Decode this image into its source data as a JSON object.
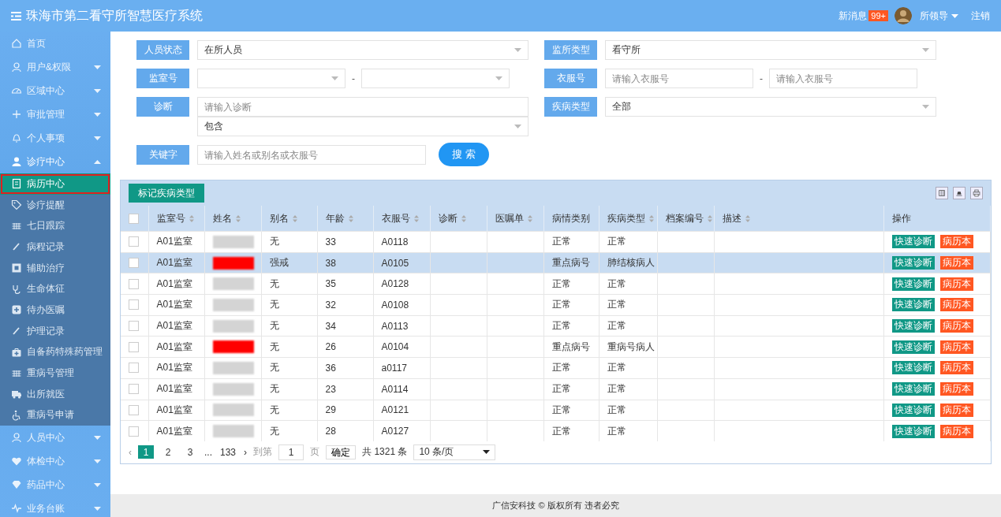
{
  "header": {
    "title": "珠海市第二看守所智慧医疗系统",
    "messages_label": "新消息",
    "messages_badge": "99+",
    "user": "所领导",
    "logout": "注销"
  },
  "sidebar": {
    "items": [
      {
        "label": "首页"
      },
      {
        "label": "用户&权限",
        "expanded": false
      },
      {
        "label": "区域中心",
        "expanded": false
      },
      {
        "label": "审批管理",
        "expanded": false
      },
      {
        "label": "个人事项",
        "expanded": false
      },
      {
        "label": "诊疗中心",
        "expanded": true,
        "children": [
          {
            "label": "病历中心",
            "selected": true
          },
          {
            "label": "诊疗提醒",
            "selected": false
          },
          {
            "label": "七日跟踪",
            "selected": false
          },
          {
            "label": "病程记录",
            "selected": false
          },
          {
            "label": "辅助治疗",
            "selected": false
          },
          {
            "label": "生命体征",
            "selected": false
          },
          {
            "label": "待办医嘱",
            "selected": false
          },
          {
            "label": "护理记录",
            "selected": false
          },
          {
            "label": "自备药特殊药管理",
            "selected": false
          },
          {
            "label": "重病号管理",
            "selected": false
          },
          {
            "label": "出所就医",
            "selected": false
          },
          {
            "label": "重病号申请",
            "selected": false
          }
        ]
      },
      {
        "label": "人员中心",
        "expanded": false
      },
      {
        "label": "体检中心",
        "expanded": false
      },
      {
        "label": "药品中心",
        "expanded": false
      },
      {
        "label": "业务台账",
        "expanded": false
      }
    ]
  },
  "filters": {
    "status": {
      "label": "人员状态",
      "value": "在所人员"
    },
    "prison_type": {
      "label": "监所类型",
      "value": "看守所"
    },
    "cell_no": {
      "label": "监室号",
      "separator": "-"
    },
    "clothes_no": {
      "label": "衣服号",
      "from_placeholder": "请输入衣服号",
      "separator": "-",
      "to_placeholder": "请输入衣服号"
    },
    "diagnosis": {
      "label": "诊断",
      "placeholder": "请输入诊断",
      "match": "包含"
    },
    "disease_type": {
      "label": "疾病类型",
      "value": "全部"
    },
    "keyword": {
      "label": "关键字",
      "placeholder": "请输入姓名或别名或衣服号"
    },
    "search_button": "搜 索"
  },
  "table": {
    "toolbar_button": "标记疾病类型",
    "all_checked": false,
    "columns": [
      {
        "label": "监室号",
        "sortable": true
      },
      {
        "label": "姓名",
        "sortable": true
      },
      {
        "label": "别名",
        "sortable": true
      },
      {
        "label": "年龄",
        "sortable": true
      },
      {
        "label": "衣服号",
        "sortable": true
      },
      {
        "label": "诊断",
        "sortable": true
      },
      {
        "label": "医嘱单",
        "sortable": true
      },
      {
        "label": "病情类别",
        "sortable": false
      },
      {
        "label": "疾病类型",
        "sortable": true
      },
      {
        "label": "档案编号",
        "sortable": true
      },
      {
        "label": "描述",
        "sortable": true
      },
      {
        "label": "操作",
        "sortable": false
      }
    ],
    "rows": [
      {
        "checked": false,
        "selected": false,
        "cell": "A01监室",
        "color": "#d4d4d4",
        "alias": "无",
        "age": "33",
        "clothes_no": "A0118",
        "condition": "正常",
        "disease_type": "正常",
        "actions": [
          "快速诊断",
          "病历本"
        ]
      },
      {
        "checked": false,
        "selected": true,
        "cell": "A01监室",
        "color": "#ff0000",
        "alias": "强戒",
        "age": "38",
        "clothes_no": "A0105",
        "condition": "重点病号",
        "disease_type": "肺结核病人",
        "actions": [
          "快速诊断",
          "病历本"
        ]
      },
      {
        "checked": false,
        "selected": false,
        "cell": "A01监室",
        "color": "#d4d4d4",
        "alias": "无",
        "age": "35",
        "clothes_no": "A0128",
        "condition": "正常",
        "disease_type": "正常",
        "actions": [
          "快速诊断",
          "病历本"
        ]
      },
      {
        "checked": false,
        "selected": false,
        "cell": "A01监室",
        "color": "#d4d4d4",
        "alias": "无",
        "age": "32",
        "clothes_no": "A0108",
        "condition": "正常",
        "disease_type": "正常",
        "actions": [
          "快速诊断",
          "病历本"
        ]
      },
      {
        "checked": false,
        "selected": false,
        "cell": "A01监室",
        "color": "#d4d4d4",
        "alias": "无",
        "age": "34",
        "clothes_no": "A0113",
        "condition": "正常",
        "disease_type": "正常",
        "actions": [
          "快速诊断",
          "病历本"
        ]
      },
      {
        "checked": false,
        "selected": false,
        "cell": "A01监室",
        "color": "#ff0000",
        "alias": "无",
        "age": "26",
        "clothes_no": "A0104",
        "condition": "重点病号",
        "disease_type": "重病号病人",
        "actions": [
          "快速诊断",
          "病历本"
        ]
      },
      {
        "checked": false,
        "selected": false,
        "cell": "A01监室",
        "color": "#d4d4d4",
        "alias": "无",
        "age": "36",
        "clothes_no": "a0117",
        "condition": "正常",
        "disease_type": "正常",
        "actions": [
          "快速诊断",
          "病历本"
        ]
      },
      {
        "checked": false,
        "selected": false,
        "cell": "A01监室",
        "color": "#d4d4d4",
        "alias": "无",
        "age": "23",
        "clothes_no": "A0114",
        "condition": "正常",
        "disease_type": "正常",
        "actions": [
          "快速诊断",
          "病历本"
        ]
      },
      {
        "checked": false,
        "selected": false,
        "cell": "A01监室",
        "color": "#d4d4d4",
        "alias": "无",
        "age": "29",
        "clothes_no": "A0121",
        "condition": "正常",
        "disease_type": "正常",
        "actions": [
          "快速诊断",
          "病历本"
        ]
      },
      {
        "checked": false,
        "selected": false,
        "cell": "A01监室",
        "color": "#d4d4d4",
        "alias": "无",
        "age": "28",
        "clothes_no": "A0127",
        "condition": "正常",
        "disease_type": "正常",
        "actions": [
          "快速诊断",
          "病历本"
        ]
      }
    ]
  },
  "pagination": {
    "prev": "‹",
    "next": "›",
    "pages": [
      {
        "label": "1",
        "selected": true
      },
      {
        "label": "2",
        "selected": false
      },
      {
        "label": "3",
        "selected": false
      }
    ],
    "ellipsis": "...",
    "last_pages": [
      {
        "label": "133",
        "selected": false
      }
    ],
    "goto_label": "到第",
    "goto_value": "1",
    "page_suffix": "页",
    "confirm": "确定",
    "total": "共 1321 条",
    "page_size": "10 条/页"
  },
  "footer": "广信安科技 © 版权所有 违者必究"
}
